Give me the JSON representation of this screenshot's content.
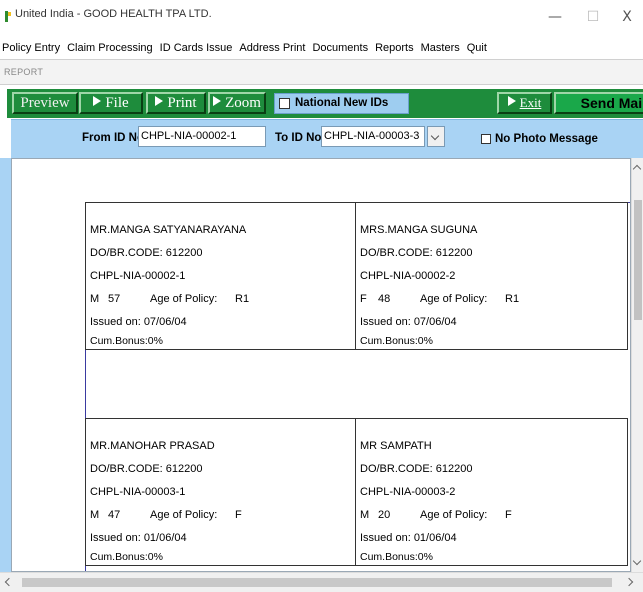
{
  "window": {
    "title": "United India - GOOD HEALTH TPA LTD.",
    "minimize": "—",
    "maximize": "☐",
    "close": "X"
  },
  "menu": [
    "Policy Entry",
    "Claim Processing",
    "ID Cards Issue",
    "Address Print",
    "Documents",
    "Reports",
    "Masters",
    "Quit"
  ],
  "section_label": "REPORT",
  "toolbar": {
    "preview": "Preview",
    "file": "File",
    "print": "Print",
    "zoom": "Zoom",
    "national_new_ids": "National New IDs",
    "exit": "Exit",
    "send_mail": "Send Mail"
  },
  "filter": {
    "from_label": "From ID No",
    "from_value": "CHPL-NIA-00002-1",
    "to_label": "To ID No",
    "to_value": "CHPL-NIA-00003-3",
    "no_photo_message": "No Photo Message"
  },
  "cards": [
    {
      "name": "MR.MANGA SATYANARAYANA",
      "code": "DO/BR.CODE: 612200",
      "id": "CHPL-NIA-00002-1",
      "sex": "M",
      "age": "57",
      "age_of_policy_label": "Age of Policy:",
      "age_of_policy": "R1",
      "issued": "Issued on:  07/06/04",
      "bonus": "Cum.Bonus:0%"
    },
    {
      "name": "MRS.MANGA SUGUNA",
      "code": "DO/BR.CODE: 612200",
      "id": "CHPL-NIA-00002-2",
      "sex": "F",
      "age": "48",
      "age_of_policy_label": "Age of Policy:",
      "age_of_policy": "R1",
      "issued": "Issued on:  07/06/04",
      "bonus": "Cum.Bonus:0%"
    },
    {
      "name": "MR.MANOHAR PRASAD",
      "code": "DO/BR.CODE: 612200",
      "id": "CHPL-NIA-00003-1",
      "sex": "M",
      "age": "47",
      "age_of_policy_label": "Age of Policy:",
      "age_of_policy": "F",
      "issued": "Issued on:  01/06/04",
      "bonus": "Cum.Bonus:0%"
    },
    {
      "name": "MR SAMPATH",
      "code": "DO/BR.CODE: 612200",
      "id": "CHPL-NIA-00003-2",
      "sex": "M",
      "age": "20",
      "age_of_policy_label": "Age of Policy:",
      "age_of_policy": "F",
      "issued": "Issued on:  01/06/04",
      "bonus": "Cum.Bonus:0%"
    }
  ]
}
